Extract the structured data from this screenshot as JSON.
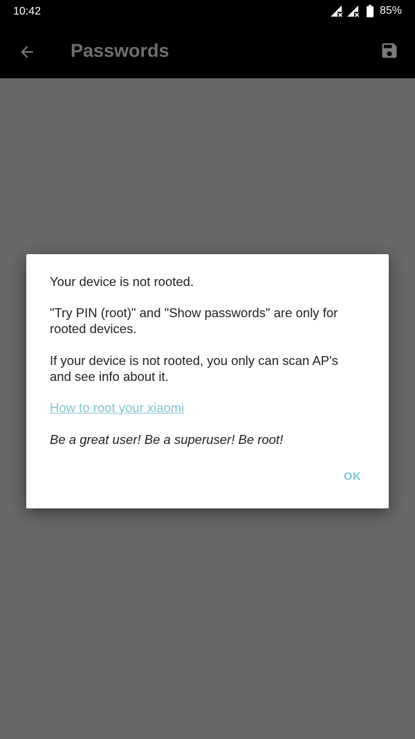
{
  "status_bar": {
    "time": "10:42",
    "icons": [
      "signal-no-data-icon",
      "signal-no-data-icon",
      "battery-icon"
    ],
    "battery_percent": "85%"
  },
  "app_bar": {
    "back_icon": "arrow-back-icon",
    "title": "Passwords",
    "save_icon": "save-icon"
  },
  "dialog": {
    "paragraph_1": "Your device is not rooted.",
    "paragraph_2": "\"Try PIN (root)\" and \"Show passwords\" are only for rooted devices.",
    "paragraph_3": "If your device is not rooted, you only can scan AP's and see info about it.",
    "link_text": "How to root your xiaomi",
    "motto": "Be a great user! Be a superuser! Be root!",
    "ok_label": "OK"
  },
  "colors": {
    "background": "#686868",
    "app_bar": "#000000",
    "title": "#6e6e6e",
    "accent": "#7fc6d2"
  }
}
